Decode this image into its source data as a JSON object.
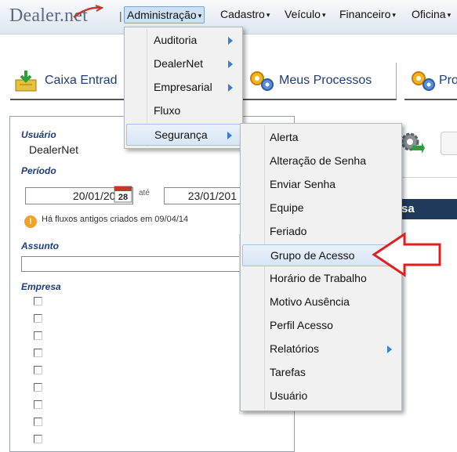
{
  "app": {
    "logo_text": "Dealer.net"
  },
  "nav": {
    "separator": "|",
    "items": [
      {
        "label": "Administração"
      },
      {
        "label": "Cadastro"
      },
      {
        "label": "Veículo"
      },
      {
        "label": "Financeiro"
      },
      {
        "label": "Oficina"
      }
    ]
  },
  "tabs": [
    {
      "label": "Caixa Entrad",
      "icon": "inbox-download-icon"
    },
    {
      "label": "Meus Processos",
      "icon": "gears-icon"
    },
    {
      "label": "Pro",
      "icon": "gears-icon"
    }
  ],
  "filters": {
    "usuario_label": "Usuário",
    "usuario_value": "DealerNet",
    "periodo_label": "Período",
    "date_from": "20/01/2015",
    "calendar_day": "28",
    "ate_label": "até",
    "date_to": "23/01/201",
    "warning_text": "Há fluxos antigos criados em 09/04/14",
    "assunto_label": "Assunto",
    "empresa_label": "Empresa"
  },
  "right_panel": {
    "header_text": "sa"
  },
  "admin_menu": {
    "items": [
      {
        "label": "Auditoria",
        "submenu": true
      },
      {
        "label": "DealerNet",
        "submenu": true
      },
      {
        "label": "Empresarial",
        "submenu": true
      },
      {
        "label": "Fluxo",
        "submenu": false
      },
      {
        "label": "Segurança",
        "submenu": true,
        "highlighted": true
      }
    ]
  },
  "seguranca_menu": {
    "items": [
      {
        "label": "Alerta"
      },
      {
        "label": "Alteração de Senha"
      },
      {
        "label": "Enviar Senha"
      },
      {
        "label": "Equipe"
      },
      {
        "label": "Feriado"
      },
      {
        "label": "Grupo de Acesso",
        "highlighted": true
      },
      {
        "label": "Horário de Trabalho"
      },
      {
        "label": "Motivo Ausência"
      },
      {
        "label": "Perfil Acesso"
      },
      {
        "label": "Relatórios",
        "submenu": true
      },
      {
        "label": "Tarefas"
      },
      {
        "label": "Usuário"
      }
    ]
  },
  "colors": {
    "accent_blue": "#1f3d7a",
    "menu_highlight": "#d7e5f5",
    "callout_red": "#e02020",
    "header_navy": "#203a5c"
  }
}
